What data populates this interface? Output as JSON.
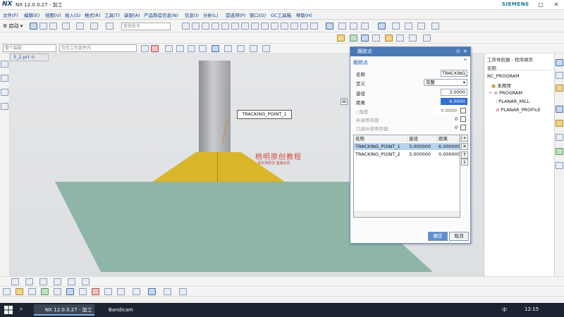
{
  "window": {
    "logo": "NX",
    "title": "NX 12.0.0.27 - 加工",
    "brand": "SIEMENS"
  },
  "menubar": {
    "items": [
      "文件(F)",
      "编辑(E)",
      "视图(V)",
      "插入(S)",
      "格式(R)",
      "工具(T)",
      "装配(A)",
      "产品制造信息(N)",
      "信息(I)",
      "分析(L)",
      "首选项(P)",
      "窗口(O)",
      "GC工具箱",
      "帮助(H)"
    ]
  },
  "toolbar": {
    "start_label": "启动",
    "command_search_placeholder": "查找命令",
    "filter_placeholder": "整个装配",
    "selection_scope_placeholder": "仅在工作部件内"
  },
  "viewport": {
    "tab_label": "5_2.prt ⊙",
    "callout": "TRACKING_POINT_1",
    "watermark_title": "杨明原创教程",
    "watermark_sub": "请支持原创 盗版必究",
    "colors": {
      "cylinder": "#a9abae",
      "hexagon": "#d9b52a",
      "plate": "#8fb5a6",
      "background": "#e1e3e5"
    }
  },
  "dialog": {
    "title": "跟踪点",
    "section": "跟踪点",
    "fields": {
      "name_label": "名称",
      "name_value": "TRACKING_",
      "define_label": "定义",
      "define_value": "完整",
      "diameter_label": "直径",
      "diameter_value": "3.0000",
      "distance_label": "距离",
      "distance_value": "6.0000",
      "angle_label": "/ 角度",
      "angle_value": "0.0000",
      "comp_reg_label": "补偿寄存器",
      "comp_reg_value": "0",
      "tool_comp_reg_label": "刀具补偿寄存器",
      "tool_comp_reg_value": "0"
    },
    "table": {
      "columns": [
        "名称",
        "直径",
        "距离"
      ],
      "rows": [
        {
          "name": "TRACKING_POINT_1",
          "diameter": "3.000000",
          "distance": "6.000000",
          "selected": true
        },
        {
          "name": "TRACKING_POINT_2",
          "diameter": "3.000000",
          "distance": "0.000000",
          "selected": false
        }
      ]
    },
    "ok_label": "确定",
    "cancel_label": "取消",
    "accent": "#4a78b6"
  },
  "navigator": {
    "title": "工序导航器 - 程序顺序",
    "column": "名称",
    "nodes": [
      {
        "label": "NC_PROGRAM",
        "level": 0
      },
      {
        "label": "未用项",
        "level": 1
      },
      {
        "label": "PROGRAM",
        "level": 1
      },
      {
        "label": "PLANAR_MILL",
        "level": 2
      },
      {
        "label": "PLANAR_PROFILE",
        "level": 2,
        "selected": true
      }
    ]
  },
  "taskbar": {
    "apps": [
      "NX 12.0.0.27 - 加工",
      "Bandicam"
    ],
    "ime": "中",
    "time": "12:15"
  }
}
